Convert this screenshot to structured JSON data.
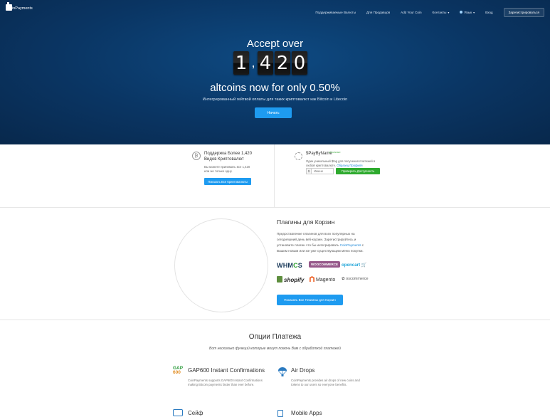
{
  "brand": {
    "name": "CoinPayments"
  },
  "nav": {
    "items": [
      "Поддерживаемые Валюты",
      "Для Продавцов",
      "Add Your Coin"
    ],
    "contacts": "Контакты",
    "language": "Язык",
    "login": "Вход",
    "signup": "Зарегистрироваться"
  },
  "hero": {
    "title_top": "Accept over",
    "counter_digits": [
      "1",
      "4",
      "2",
      "0"
    ],
    "counter_separator": ",",
    "title_bottom": "altcoins now for only 0.50%",
    "subtitle": "Интегрированный гейтвой оплаты для таких криптовалют как Bitcoin и Litecoin",
    "cta": "Начать"
  },
  "features": {
    "coins": {
      "icon": "bitcoin-coin-icon",
      "title": "Поддержка Более 1,420 Видов Криптовалют",
      "text": "Вы можете принимать все 1,420 или же только одну.",
      "button": "Показать Все Криптовалюты"
    },
    "paybyname": {
      "icon": "gear-icon",
      "title": "$PayByName",
      "badge": "ADVANCED",
      "text": "Один уникальный $tag для получения платежей в любой криптовалюте.",
      "link": "Образец Профиля",
      "currency_symbol": "$",
      "input_placeholder": "Имени",
      "button": "Проверить Доступность"
    }
  },
  "plugins": {
    "title": "Плагины для Корзин",
    "text_before": "Предоставление плагинов для всех популярных на сегодняшний день веб-корзин. Зарегистрируйтесь и установите плагин что бы интегрировать ",
    "text_link": "CoinPayments",
    "text_after": " с Вашим новым или же уже существующим меню покупки.",
    "logos": {
      "whmcs_a": "WHM",
      "whmcs_o": "C",
      "whmcs_b": "S",
      "woo": "WOOCOMMERCE",
      "opencart": "opencart",
      "shopify": "shopify",
      "magento": "Magento",
      "oscommerce": "oscommerce"
    },
    "button": "Показать Все Плагины для Корзин"
  },
  "options": {
    "title": "Опции Платежа",
    "subtitle": "Вот несколько функций которые могут помочь Вам с обработкой платежей",
    "items": [
      {
        "icon": "gap600-icon",
        "icon_text_top": "GAP",
        "icon_text_bottom": "600",
        "title": "GAP600 Instant Confirmations",
        "text": "CoinPayments supports GAP600 Instant Confirmations making Bitcoin payments faster than ever before."
      },
      {
        "icon": "parachute-icon",
        "title": "Air Drops",
        "text": "CoinPayments provides air drops of new coins and tokens to our users so everyone benefits."
      },
      {
        "icon": "safe-icon",
        "title": "Сейф"
      },
      {
        "icon": "mobile-icon",
        "title": "Mobile Apps"
      }
    ]
  },
  "colors": {
    "hero_bg": "#0a3563",
    "accent_blue": "#1e9bf0",
    "success_green": "#2eaa2e"
  }
}
